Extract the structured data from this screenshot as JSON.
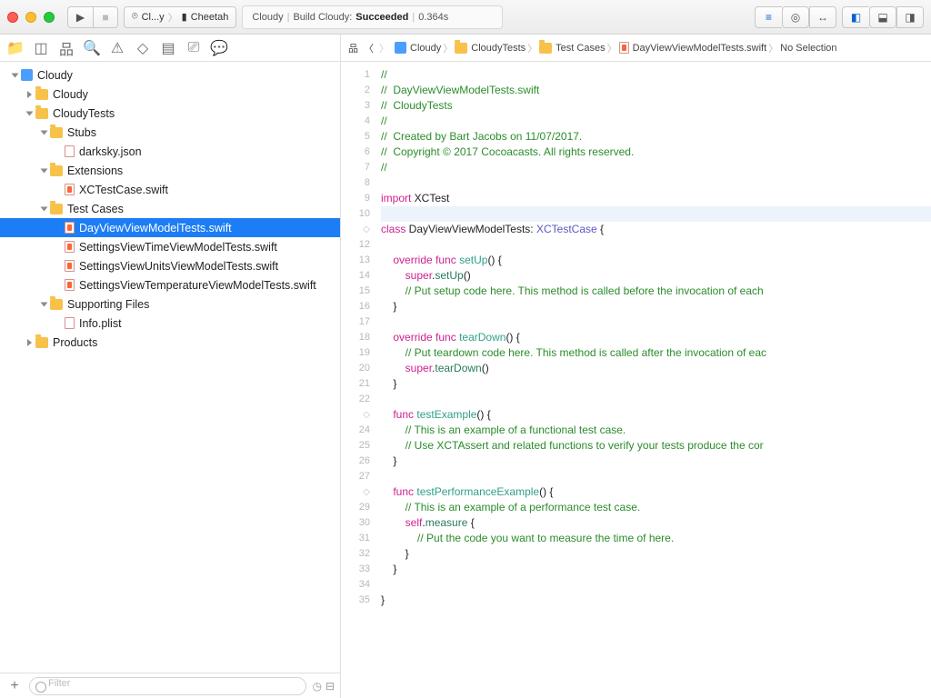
{
  "toolbar": {
    "scheme": {
      "target": "Cl...y",
      "device": "Cheetah"
    },
    "status": {
      "project": "Cloudy",
      "action": "Build Cloudy:",
      "result": "Succeeded",
      "time": "0.364s"
    }
  },
  "breadcrumb": [
    {
      "icon": "proj",
      "label": "Cloudy"
    },
    {
      "icon": "folder",
      "label": "CloudyTests"
    },
    {
      "icon": "folder",
      "label": "Test Cases"
    },
    {
      "icon": "swift",
      "label": "DayViewViewModelTests.swift"
    },
    {
      "icon": "none",
      "label": "No Selection"
    }
  ],
  "tree": [
    {
      "d": 0,
      "exp": "open",
      "icon": "proj",
      "label": "Cloudy"
    },
    {
      "d": 1,
      "exp": "closed",
      "icon": "folder",
      "label": "Cloudy"
    },
    {
      "d": 1,
      "exp": "open",
      "icon": "folder",
      "label": "CloudyTests"
    },
    {
      "d": 2,
      "exp": "open",
      "icon": "folder",
      "label": "Stubs"
    },
    {
      "d": 3,
      "exp": "none",
      "icon": "json",
      "label": "darksky.json"
    },
    {
      "d": 2,
      "exp": "open",
      "icon": "folder",
      "label": "Extensions"
    },
    {
      "d": 3,
      "exp": "none",
      "icon": "swift",
      "label": "XCTestCase.swift"
    },
    {
      "d": 2,
      "exp": "open",
      "icon": "folder",
      "label": "Test Cases"
    },
    {
      "d": 3,
      "exp": "none",
      "icon": "swift",
      "label": "DayViewViewModelTests.swift",
      "sel": true
    },
    {
      "d": 3,
      "exp": "none",
      "icon": "swift",
      "label": "SettingsViewTimeViewModelTests.swift"
    },
    {
      "d": 3,
      "exp": "none",
      "icon": "swift",
      "label": "SettingsViewUnitsViewModelTests.swift"
    },
    {
      "d": 3,
      "exp": "none",
      "icon": "swift",
      "label": "SettingsViewTemperatureViewModelTests.swift"
    },
    {
      "d": 2,
      "exp": "open",
      "icon": "folder",
      "label": "Supporting Files"
    },
    {
      "d": 3,
      "exp": "none",
      "icon": "plist",
      "label": "Info.plist"
    },
    {
      "d": 1,
      "exp": "closed",
      "icon": "folder",
      "label": "Products"
    }
  ],
  "filter_placeholder": "Filter",
  "code": {
    "lines": [
      {
        "n": "1",
        "g": "",
        "tokens": [
          [
            "cmt",
            "//"
          ]
        ]
      },
      {
        "n": "2",
        "g": "",
        "tokens": [
          [
            "cmt",
            "//  DayViewViewModelTests.swift"
          ]
        ]
      },
      {
        "n": "3",
        "g": "",
        "tokens": [
          [
            "cmt",
            "//  CloudyTests"
          ]
        ]
      },
      {
        "n": "4",
        "g": "",
        "tokens": [
          [
            "cmt",
            "//"
          ]
        ]
      },
      {
        "n": "5",
        "g": "",
        "tokens": [
          [
            "cmt",
            "//  Created by Bart Jacobs on 11/07/2017."
          ]
        ]
      },
      {
        "n": "6",
        "g": "",
        "tokens": [
          [
            "cmt",
            "//  Copyright © 2017 Cocoacasts. All rights reserved."
          ]
        ]
      },
      {
        "n": "7",
        "g": "",
        "tokens": [
          [
            "cmt",
            "//"
          ]
        ]
      },
      {
        "n": "8",
        "g": "",
        "tokens": [
          [
            "",
            ""
          ]
        ]
      },
      {
        "n": "9",
        "g": "",
        "tokens": [
          [
            "kw",
            "import"
          ],
          [
            "",
            " XCTest"
          ]
        ]
      },
      {
        "n": "10",
        "g": "",
        "hl": true,
        "tokens": [
          [
            "",
            ""
          ]
        ]
      },
      {
        "n": "",
        "g": "◇",
        "tokens": [
          [
            "kw",
            "class"
          ],
          [
            "",
            " DayViewViewModelTests: "
          ],
          [
            "cls",
            "XCTestCase"
          ],
          [
            "",
            " {"
          ]
        ]
      },
      {
        "n": "12",
        "g": "",
        "tokens": [
          [
            "",
            ""
          ]
        ]
      },
      {
        "n": "13",
        "g": "",
        "tokens": [
          [
            "",
            "    "
          ],
          [
            "kw",
            "override"
          ],
          [
            "",
            " "
          ],
          [
            "kw",
            "func"
          ],
          [
            "",
            " "
          ],
          [
            "id",
            "setUp"
          ],
          [
            "",
            "() {"
          ]
        ]
      },
      {
        "n": "14",
        "g": "",
        "tokens": [
          [
            "",
            "        "
          ],
          [
            "kw",
            "super"
          ],
          [
            "",
            "."
          ],
          [
            "mtd",
            "setUp"
          ],
          [
            "",
            "()"
          ]
        ]
      },
      {
        "n": "15",
        "g": "",
        "tokens": [
          [
            "",
            "        "
          ],
          [
            "cmt",
            "// Put setup code here. This method is called before the invocation of each"
          ]
        ]
      },
      {
        "n": "16",
        "g": "",
        "tokens": [
          [
            "",
            "    }"
          ]
        ]
      },
      {
        "n": "17",
        "g": "",
        "tokens": [
          [
            "",
            ""
          ]
        ]
      },
      {
        "n": "18",
        "g": "",
        "tokens": [
          [
            "",
            "    "
          ],
          [
            "kw",
            "override"
          ],
          [
            "",
            " "
          ],
          [
            "kw",
            "func"
          ],
          [
            "",
            " "
          ],
          [
            "id",
            "tearDown"
          ],
          [
            "",
            "() {"
          ]
        ]
      },
      {
        "n": "19",
        "g": "",
        "tokens": [
          [
            "",
            "        "
          ],
          [
            "cmt",
            "// Put teardown code here. This method is called after the invocation of eac"
          ]
        ]
      },
      {
        "n": "20",
        "g": "",
        "tokens": [
          [
            "",
            "        "
          ],
          [
            "kw",
            "super"
          ],
          [
            "",
            "."
          ],
          [
            "mtd",
            "tearDown"
          ],
          [
            "",
            "()"
          ]
        ]
      },
      {
        "n": "21",
        "g": "",
        "tokens": [
          [
            "",
            "    }"
          ]
        ]
      },
      {
        "n": "22",
        "g": "",
        "tokens": [
          [
            "",
            ""
          ]
        ]
      },
      {
        "n": "",
        "g": "◇",
        "tokens": [
          [
            "",
            "    "
          ],
          [
            "kw",
            "func"
          ],
          [
            "",
            " "
          ],
          [
            "id",
            "testExample"
          ],
          [
            "",
            "() {"
          ]
        ]
      },
      {
        "n": "24",
        "g": "",
        "tokens": [
          [
            "",
            "        "
          ],
          [
            "cmt",
            "// This is an example of a functional test case."
          ]
        ]
      },
      {
        "n": "25",
        "g": "",
        "tokens": [
          [
            "",
            "        "
          ],
          [
            "cmt",
            "// Use XCTAssert and related functions to verify your tests produce the cor"
          ]
        ]
      },
      {
        "n": "26",
        "g": "",
        "tokens": [
          [
            "",
            "    }"
          ]
        ]
      },
      {
        "n": "27",
        "g": "",
        "tokens": [
          [
            "",
            ""
          ]
        ]
      },
      {
        "n": "",
        "g": "◇",
        "tokens": [
          [
            "",
            "    "
          ],
          [
            "kw",
            "func"
          ],
          [
            "",
            " "
          ],
          [
            "id",
            "testPerformanceExample"
          ],
          [
            "",
            "() {"
          ]
        ]
      },
      {
        "n": "29",
        "g": "",
        "tokens": [
          [
            "",
            "        "
          ],
          [
            "cmt",
            "// This is an example of a performance test case."
          ]
        ]
      },
      {
        "n": "30",
        "g": "",
        "tokens": [
          [
            "",
            "        "
          ],
          [
            "kw",
            "self"
          ],
          [
            "",
            "."
          ],
          [
            "mtd",
            "measure"
          ],
          [
            "",
            " {"
          ]
        ]
      },
      {
        "n": "31",
        "g": "",
        "tokens": [
          [
            "",
            "            "
          ],
          [
            "cmt",
            "// Put the code you want to measure the time of here."
          ]
        ]
      },
      {
        "n": "32",
        "g": "",
        "tokens": [
          [
            "",
            "        }"
          ]
        ]
      },
      {
        "n": "33",
        "g": "",
        "tokens": [
          [
            "",
            "    }"
          ]
        ]
      },
      {
        "n": "34",
        "g": "",
        "tokens": [
          [
            "",
            ""
          ]
        ]
      },
      {
        "n": "35",
        "g": "",
        "tokens": [
          [
            "",
            "}"
          ]
        ]
      },
      {
        "n": "",
        "g": "",
        "tokens": [
          [
            "",
            ""
          ]
        ]
      }
    ]
  }
}
